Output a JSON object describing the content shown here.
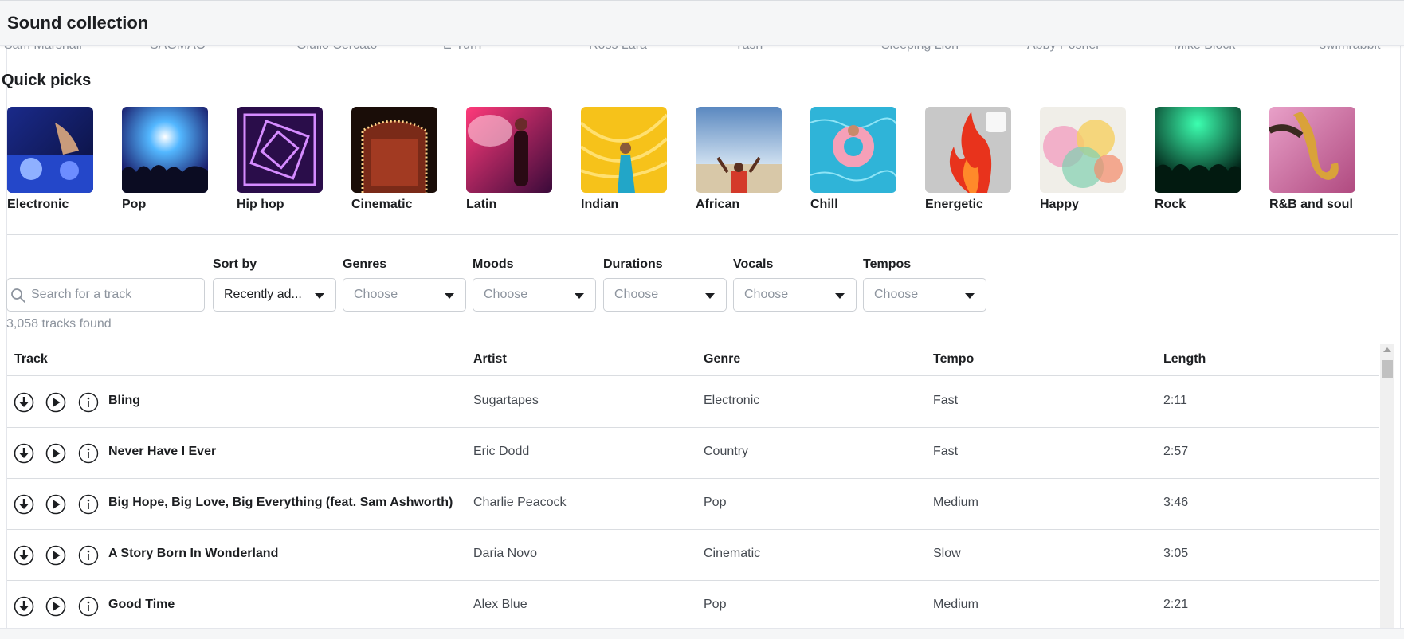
{
  "header": {
    "title": "Sound collection"
  },
  "artists_strip": [
    "Sam Marshall",
    "SAGMAO",
    "Giulio Cercato",
    "E-Turn",
    "Ross Lara",
    "Yash",
    "Sleeping Lion",
    "Abby Posner",
    "Mike Block",
    "swimrabbit"
  ],
  "quick_picks": {
    "title": "Quick picks",
    "items": [
      {
        "label": "Electronic",
        "icon": "dj-mixer-image"
      },
      {
        "label": "Pop",
        "icon": "concert-crowd-image"
      },
      {
        "label": "Hip hop",
        "icon": "neon-tunnel-image"
      },
      {
        "label": "Cinematic",
        "icon": "theater-stage-image"
      },
      {
        "label": "Latin",
        "icon": "singer-on-stage-image"
      },
      {
        "label": "Indian",
        "icon": "dancer-yellow-image"
      },
      {
        "label": "African",
        "icon": "man-raising-arms-image"
      },
      {
        "label": "Chill",
        "icon": "pool-float-image"
      },
      {
        "label": "Energetic",
        "icon": "red-flame-image",
        "selected": true
      },
      {
        "label": "Happy",
        "icon": "color-powder-image"
      },
      {
        "label": "Rock",
        "icon": "green-stage-lights-image"
      },
      {
        "label": "R&B and soul",
        "icon": "saxophone-image"
      }
    ]
  },
  "filters": {
    "search_placeholder": "Search for a track",
    "sort_by": {
      "label": "Sort by",
      "value": "Recently ad..."
    },
    "genres": {
      "label": "Genres",
      "value": "Choose"
    },
    "moods": {
      "label": "Moods",
      "value": "Choose"
    },
    "durations": {
      "label": "Durations",
      "value": "Choose"
    },
    "vocals": {
      "label": "Vocals",
      "value": "Choose"
    },
    "tempos": {
      "label": "Tempos",
      "value": "Choose"
    }
  },
  "results_count": "3,058 tracks found",
  "table": {
    "columns": [
      "Track",
      "Artist",
      "Genre",
      "Tempo",
      "Length"
    ],
    "rows": [
      {
        "track": "Bling",
        "artist": "Sugartapes",
        "genre": "Electronic",
        "tempo": "Fast",
        "length": "2:11"
      },
      {
        "track": "Never Have I Ever",
        "artist": "Eric Dodd",
        "genre": "Country",
        "tempo": "Fast",
        "length": "2:57"
      },
      {
        "track": "Big Hope, Big Love, Big Everything (feat. Sam Ashworth)",
        "artist": "Charlie Peacock",
        "genre": "Pop",
        "tempo": "Medium",
        "length": "3:46"
      },
      {
        "track": "A Story Born In Wonderland",
        "artist": "Daria Novo",
        "genre": "Cinematic",
        "tempo": "Slow",
        "length": "3:05"
      },
      {
        "track": "Good Time",
        "artist": "Alex Blue",
        "genre": "Pop",
        "tempo": "Medium",
        "length": "2:21"
      }
    ]
  },
  "colors": {
    "text": "#1c1e21",
    "muted": "#8d949e",
    "border": "#dadde1"
  }
}
